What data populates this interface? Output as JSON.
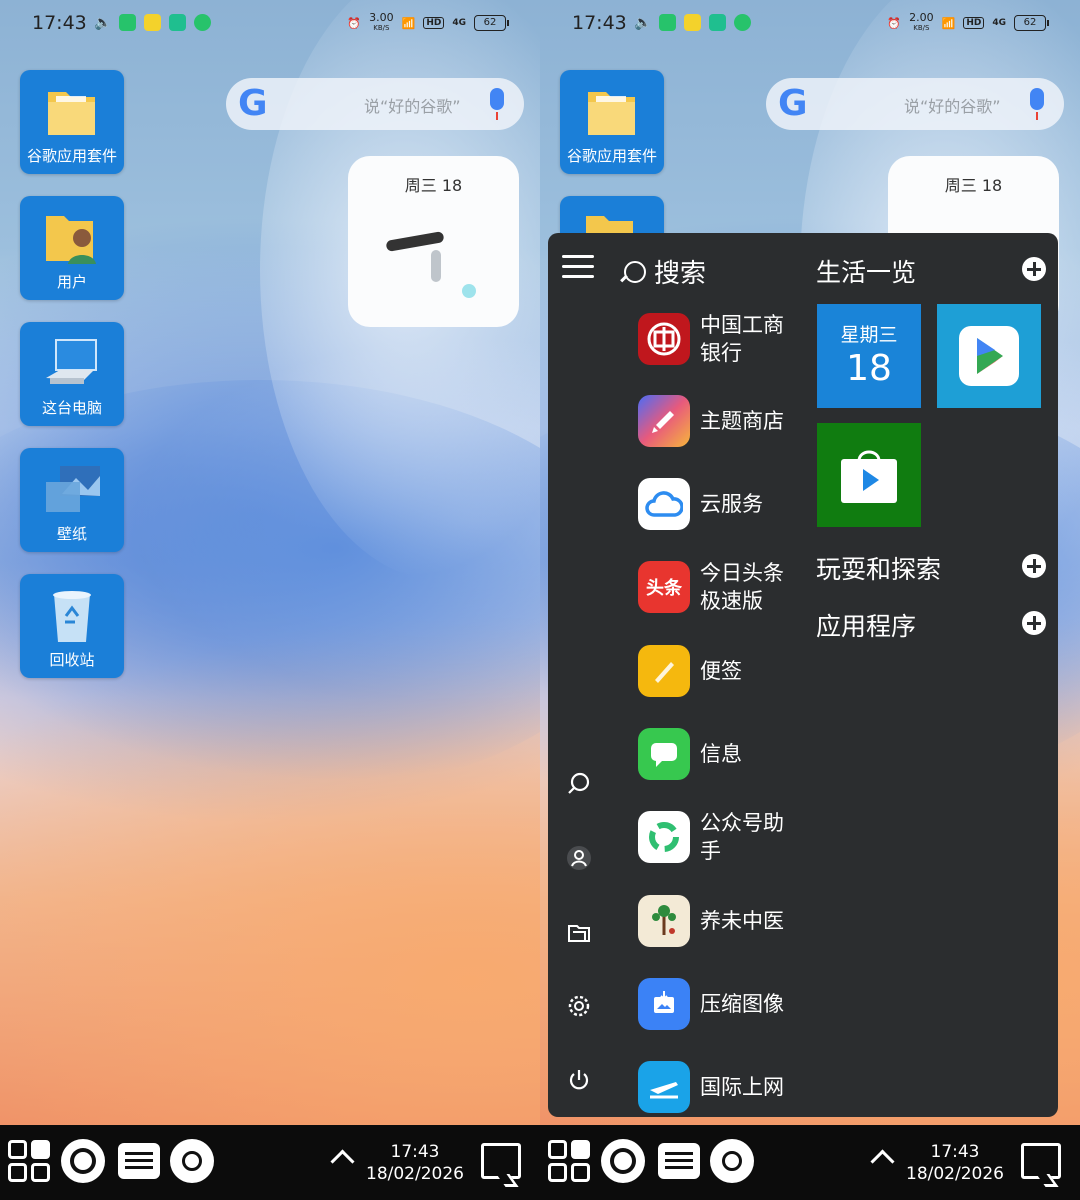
{
  "status_bar": {
    "time": "17:43",
    "speed_left": "3.00",
    "speed_right": "2.00",
    "speed_unit": "KB/S",
    "hd": "HD",
    "network": "4G",
    "battery": "62"
  },
  "desktop": {
    "icons": [
      {
        "label": "谷歌应用套件"
      },
      {
        "label": "用户"
      },
      {
        "label": "这台电脑"
      },
      {
        "label": "壁纸"
      },
      {
        "label": "回收站"
      }
    ],
    "google_search": {
      "logo": "G",
      "placeholder": "说“好的谷歌”"
    },
    "clock_widget": {
      "date": "周三 18"
    }
  },
  "start_menu": {
    "search_label": "搜索",
    "apps": [
      {
        "name": "中国工商\n银行",
        "icon": "icbc-icon",
        "color": "#c0171d",
        "glyph": "工"
      },
      {
        "name": "主题商店",
        "icon": "theme-store-icon",
        "color": "#e85a7c",
        "glyph": ""
      },
      {
        "name": "云服务",
        "icon": "cloud-icon",
        "color": "#ffffff",
        "glyph": ""
      },
      {
        "name": "今日头条\n极速版",
        "icon": "toutiao-icon",
        "color": "#e8352f",
        "glyph": "头条"
      },
      {
        "name": "便签",
        "icon": "notes-icon",
        "color": "#f5b80e",
        "glyph": ""
      },
      {
        "name": "信息",
        "icon": "messages-icon",
        "color": "#37c84f",
        "glyph": ""
      },
      {
        "name": "公众号助\n手",
        "icon": "wechat-assistant-icon",
        "color": "#ffffff",
        "glyph": ""
      },
      {
        "name": "养未中医",
        "icon": "tcm-icon",
        "color": "#f3ead6",
        "glyph": ""
      },
      {
        "name": "压缩图像",
        "icon": "compress-image-icon",
        "color": "#3b82f6",
        "glyph": ""
      },
      {
        "name": "国际上网",
        "icon": "airplane-icon",
        "color": "#1aa3e8",
        "glyph": ""
      }
    ],
    "groups": [
      {
        "title": "生活一览"
      },
      {
        "title": "玩耍和探索"
      },
      {
        "title": "应用程序"
      }
    ],
    "calendar_tile": {
      "weekday": "星期三",
      "day": "18"
    }
  },
  "taskbar": {
    "time": "17:43",
    "date": "18/02/2026"
  },
  "colors": {
    "tile_blue": "#1a84d8",
    "tile_green": "#107c10",
    "menu_bg": "#2b2d2f"
  }
}
